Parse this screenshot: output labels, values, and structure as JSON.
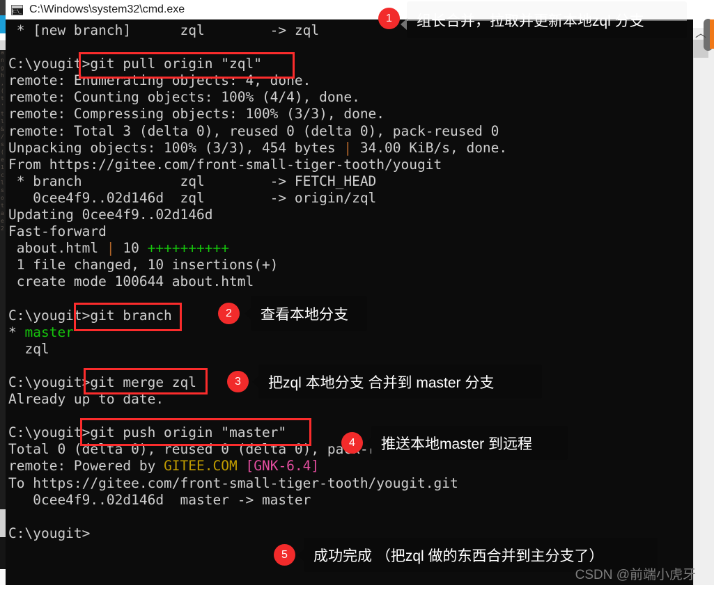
{
  "window": {
    "title": "C:\\Windows\\system32\\cmd.exe",
    "icon": "cmd-icon"
  },
  "terminal": {
    "lines": [
      {
        "segments": [
          {
            "text": " * [new branch]      zql        -> zql",
            "color": "default"
          }
        ]
      },
      {
        "segments": [
          {
            "text": "",
            "color": "default"
          }
        ]
      },
      {
        "segments": [
          {
            "text": "C:\\yougit>git pull origin \"zql\"",
            "color": "default"
          }
        ]
      },
      {
        "segments": [
          {
            "text": "remote: Enumerating objects: 4, done.",
            "color": "default"
          }
        ]
      },
      {
        "segments": [
          {
            "text": "remote: Counting objects: 100% (4/4), done.",
            "color": "default"
          }
        ]
      },
      {
        "segments": [
          {
            "text": "remote: Compressing objects: 100% (3/3), done.",
            "color": "default"
          }
        ]
      },
      {
        "segments": [
          {
            "text": "remote: Total 3 (delta 0), reused 0 (delta 0), pack-reused 0",
            "color": "default"
          }
        ]
      },
      {
        "segments": [
          {
            "text": "Unpacking objects: 100% (3/3), 454 bytes ",
            "color": "default"
          },
          {
            "text": "|",
            "color": "orange"
          },
          {
            "text": " 34.00 KiB/s, done.",
            "color": "default"
          }
        ]
      },
      {
        "segments": [
          {
            "text": "From https://gitee.com/front-small-tiger-tooth/yougit",
            "color": "default"
          }
        ]
      },
      {
        "segments": [
          {
            "text": " * branch            zql        -> FETCH_HEAD",
            "color": "default"
          }
        ]
      },
      {
        "segments": [
          {
            "text": "   0cee4f9..02d146d  zql        -> origin/zql",
            "color": "default"
          }
        ]
      },
      {
        "segments": [
          {
            "text": "Updating 0cee4f9..02d146d",
            "color": "default"
          }
        ]
      },
      {
        "segments": [
          {
            "text": "Fast-forward",
            "color": "default"
          }
        ]
      },
      {
        "segments": [
          {
            "text": " about.html ",
            "color": "default"
          },
          {
            "text": "|",
            "color": "orange"
          },
          {
            "text": " 10 ",
            "color": "default"
          },
          {
            "text": "++++++++++",
            "color": "green"
          }
        ]
      },
      {
        "segments": [
          {
            "text": " 1 file changed, 10 insertions(+)",
            "color": "default"
          }
        ]
      },
      {
        "segments": [
          {
            "text": " create mode 100644 about.html",
            "color": "default"
          }
        ]
      },
      {
        "segments": [
          {
            "text": "",
            "color": "default"
          }
        ]
      },
      {
        "segments": [
          {
            "text": "C:\\yougit>git branch",
            "color": "default"
          }
        ]
      },
      {
        "segments": [
          {
            "text": "* ",
            "color": "default"
          },
          {
            "text": "master",
            "color": "green"
          }
        ]
      },
      {
        "segments": [
          {
            "text": "  zql",
            "color": "default"
          }
        ]
      },
      {
        "segments": [
          {
            "text": "",
            "color": "default"
          }
        ]
      },
      {
        "segments": [
          {
            "text": "C:\\yougit>git merge zql",
            "color": "default"
          }
        ]
      },
      {
        "segments": [
          {
            "text": "Already up to date.",
            "color": "default"
          }
        ]
      },
      {
        "segments": [
          {
            "text": "",
            "color": "default"
          }
        ]
      },
      {
        "segments": [
          {
            "text": "C:\\yougit>git push origin \"master\"",
            "color": "default"
          }
        ]
      },
      {
        "segments": [
          {
            "text": "Total 0 (delta 0), reused 0 (delta 0), pack-reused 0",
            "color": "default"
          }
        ]
      },
      {
        "segments": [
          {
            "text": "remote: Powered by ",
            "color": "default"
          },
          {
            "text": "GITEE.COM",
            "color": "yellow"
          },
          {
            "text": " ",
            "color": "default"
          },
          {
            "text": "[GNK-6.4]",
            "color": "magenta"
          }
        ]
      },
      {
        "segments": [
          {
            "text": "To https://gitee.com/front-small-tiger-tooth/yougit.git",
            "color": "default"
          }
        ]
      },
      {
        "segments": [
          {
            "text": "   0cee4f9..02d146d  master -> master",
            "color": "default"
          }
        ]
      },
      {
        "segments": [
          {
            "text": "",
            "color": "default"
          }
        ]
      },
      {
        "segments": [
          {
            "text": "C:\\yougit>",
            "color": "default"
          }
        ]
      }
    ]
  },
  "annotations": [
    {
      "number": "1",
      "label": "组长合并，拉取并更新本地zql 分支"
    },
    {
      "number": "2",
      "label": "查看本地分支"
    },
    {
      "number": "3",
      "label": "把zql 本地分支 合并到 master 分支"
    },
    {
      "number": "4",
      "label": "推送本地master 到远程"
    },
    {
      "number": "5",
      "label": "成功完成 （把zql 做的东西合并到主分支了）"
    }
  ],
  "highlights": [
    {
      "target": "git pull origin \"zql\""
    },
    {
      "target": "git branch"
    },
    {
      "target": "git merge zql"
    },
    {
      "target": "git push origin \"master\""
    }
  ],
  "watermark": "CSDN @前端小虎牙",
  "colors": {
    "accent_red": "#f22b2b",
    "terminal_bg": "#0c0c0c",
    "terminal_fg": "#cfcfcf",
    "green": "#16c60c",
    "yellow": "#c19c00",
    "magenta": "#e54ea0",
    "scroll_accent": "#f07818"
  },
  "scrollbar": {
    "chevron": "︿"
  }
}
